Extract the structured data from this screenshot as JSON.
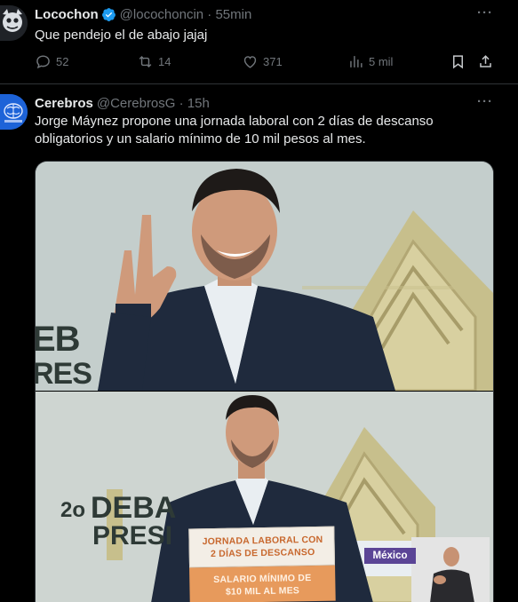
{
  "tweets": [
    {
      "name": "Locochon",
      "verified": true,
      "handle": "@locochoncin · 55min",
      "text": "Que pendejo el de abajo jajaj",
      "stats": {
        "replies": "52",
        "retweets": "14",
        "likes": "371",
        "views": "5 mil"
      },
      "more": "···"
    },
    {
      "name": "Cerebros",
      "handle": "@CerebrosG · 15h",
      "text": "Jorge Máynez propone una jornada laboral con 2 días de descanso obligatorios y un salario mínimo de 10 mil pesos al mes.",
      "more": "···",
      "media": {
        "top_frame_text": [
          "EB",
          "RES"
        ],
        "bottom_frame_text": [
          "2o",
          "DEBA",
          "PRESI"
        ],
        "sign_lines": [
          "JORNADA LABORAL CON",
          "2 DÍAS DE DESCANSO",
          "SALARIO MÍNIMO DE",
          "$10 MIL AL MES"
        ],
        "badge": "México"
      }
    }
  ],
  "colors": {
    "background": "#000000",
    "text_primary": "#e7e9ea",
    "text_secondary": "#71767b",
    "verified_blue": "#1d9bf0",
    "divider": "#2f3336"
  }
}
